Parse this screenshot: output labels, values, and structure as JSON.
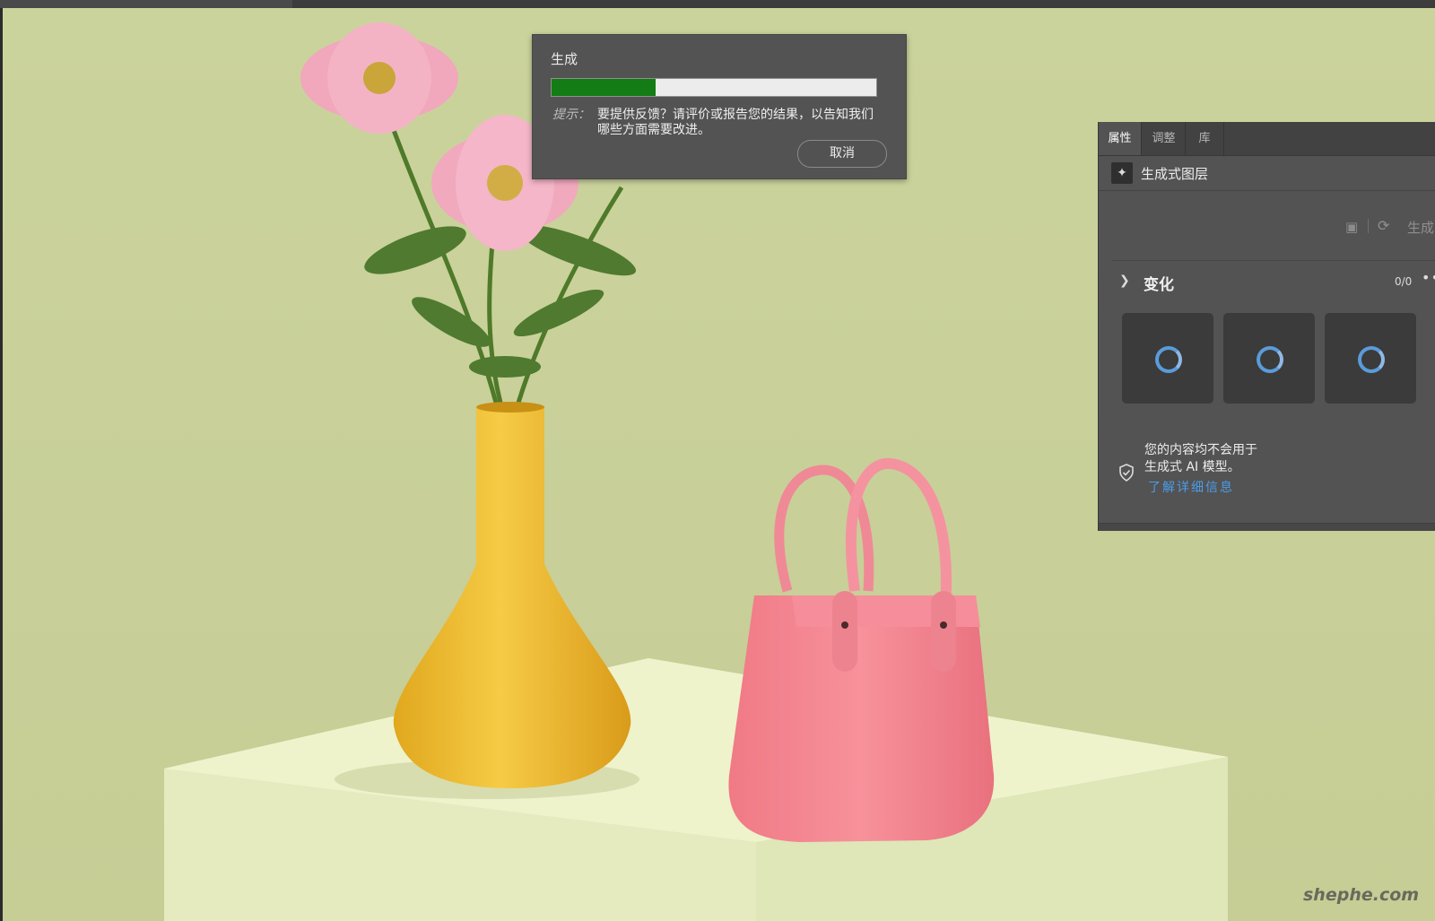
{
  "progress_dialog": {
    "title": "生成",
    "progress_percent": 32,
    "tip_label": "提示：",
    "tip_text": "要提供反馈？请评价或报告您的结果，以告知我们哪些方面需要改进。",
    "cancel_label": "取消"
  },
  "properties_panel": {
    "tabs": [
      {
        "label": "属性",
        "active": true
      },
      {
        "label": "调整",
        "active": false
      },
      {
        "label": "库",
        "active": false
      }
    ],
    "layer_name": "生成式图层",
    "generate_label": "生成",
    "variations_title": "变化",
    "variations_count": "0/0",
    "variation_thumbnails": [
      "loading",
      "loading",
      "loading"
    ],
    "notice_line1": "您的内容均不会用于",
    "notice_line2": "生成式 AI 模型。",
    "learn_more": "了解详细信息"
  },
  "watermark": "shephe.com",
  "colors": {
    "progress_fill": "#147c14",
    "panel_bg": "#535353",
    "link": "#4b9ce8",
    "spinner": "#5b9bd9"
  }
}
